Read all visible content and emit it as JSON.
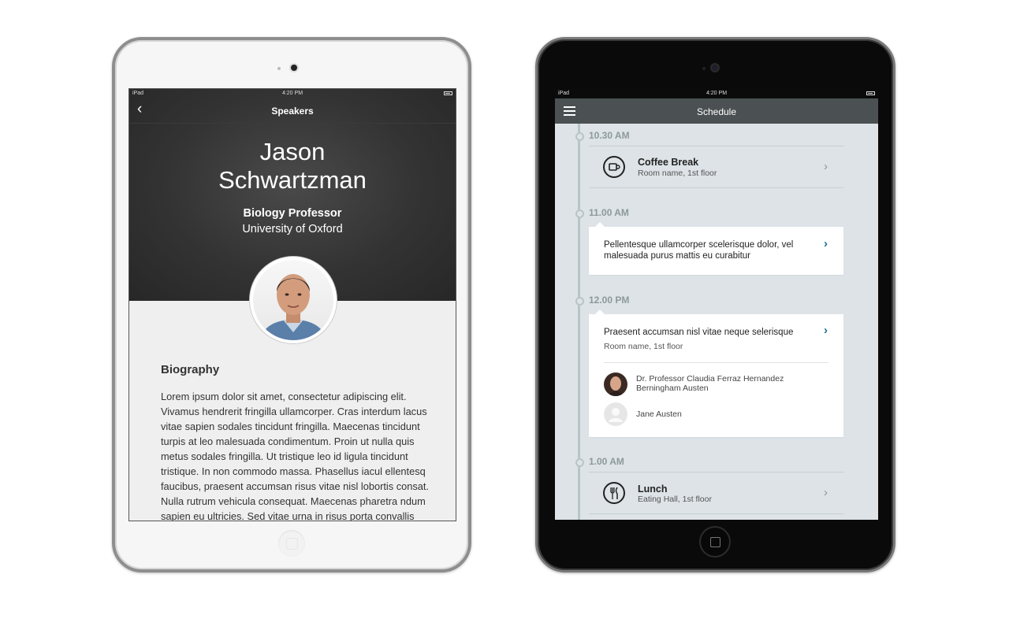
{
  "speakers_screen": {
    "status": {
      "carrier": "iPad",
      "time": "4:20 PM"
    },
    "nav_title": "Speakers",
    "speaker": {
      "first_name": "Jason",
      "last_name": "Schwartzman",
      "role": "Biology Professor",
      "institution": "University of Oxford"
    },
    "biography_heading": "Biography",
    "biography_text": "Lorem ipsum dolor sit amet, consectetur adipiscing elit. Vivamus hendrerit fringilla ullamcorper. Cras interdum lacus vitae sapien sodales tincidunt fringilla. Maecenas tincidunt turpis at leo malesuada condimentum. Proin ut nulla quis metus sodales fringilla. Ut tristique leo id ligula tincidunt tristique. In non commodo massa. Phasellus iacul ellentesq faucibus, praesent accumsan risus vitae nisl lobortis consat. Nulla rutrum vehicula consequat. Maecenas pharetra ndum sapien eu ultricies. Sed vitae urna in risus porta convallis"
  },
  "schedule_screen": {
    "status": {
      "carrier": "iPad",
      "time": "4:20 PM"
    },
    "nav_title": "Schedule",
    "slots": [
      {
        "time": "10.30 AM",
        "item": {
          "title": "Coffee Break",
          "subtitle": "Room name, 1st floor",
          "icon": "coffee-cup-icon"
        }
      },
      {
        "time": "11.00 AM",
        "card": {
          "text": "Pellentesque ullamcorper scelerisque dolor, vel malesuada purus mattis eu curabitur"
        }
      },
      {
        "time": "12.00 PM",
        "card": {
          "text": "Praesent accumsan nisl vitae neque selerisque",
          "subtitle": "Room name, 1st floor",
          "speakers": [
            {
              "name_line1": "Dr. Professor Claudia Ferraz Hernandez",
              "name_line2": "Berningham Austen"
            },
            {
              "name_line1": "Jane Austen",
              "name_line2": ""
            }
          ]
        }
      },
      {
        "time": "1.00 AM",
        "item": {
          "title": "Lunch",
          "subtitle": "Eating Hall, 1st floor",
          "icon": "fork-knife-icon"
        }
      }
    ]
  },
  "colors": {
    "schedule_nav": "#4b5152",
    "schedule_bg": "#dde3e6",
    "accent_chevron": "#1f6c9d",
    "hero_bg": "#333333"
  }
}
